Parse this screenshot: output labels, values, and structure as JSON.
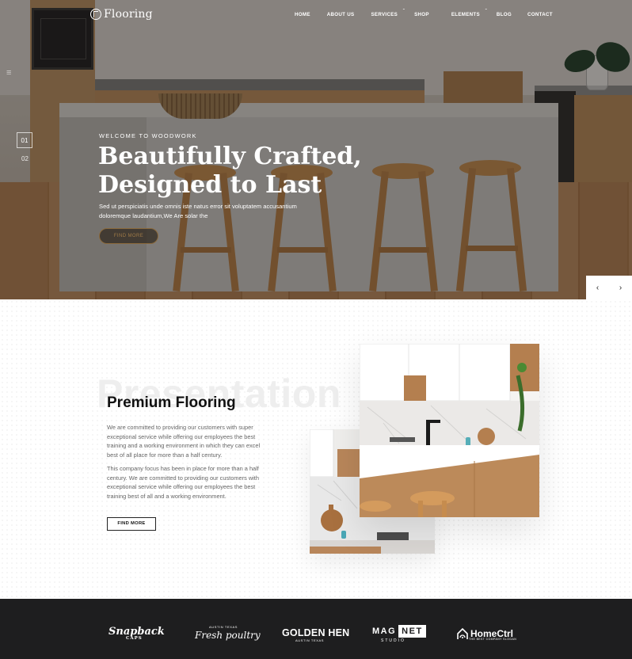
{
  "brand": {
    "logo_text": "Flooring",
    "logo_icon": "circle-leaf-icon"
  },
  "nav": {
    "items": [
      {
        "label": "HOME",
        "has_dropdown": false
      },
      {
        "label": "ABOUT US",
        "has_dropdown": false
      },
      {
        "label": "SERVICES",
        "has_dropdown": true
      },
      {
        "label": "SHOP",
        "has_dropdown": false
      },
      {
        "label": "ELEMENTS",
        "has_dropdown": true
      },
      {
        "label": "BLOG",
        "has_dropdown": false
      },
      {
        "label": "CONTACT",
        "has_dropdown": false
      }
    ]
  },
  "hero": {
    "kicker": "WELCOME TO WOODWORK",
    "title": "Beautifully Crafted, Designed to Last",
    "description": "Sed ut perspiciatis unde omnis iste natus error sit voluptatem accusantium doloremque laudantium,We Are solar the",
    "button_label": "FIND MORE",
    "slides": {
      "active": "01",
      "next": "02"
    },
    "prev_arrow": "‹",
    "next_arrow": "›"
  },
  "presentation": {
    "watermark": "Presentation",
    "title_plain": "Premium",
    "title_accent": "Flooring",
    "paragraph_1": "We are committed to providing our customers with super exceptional service while offering our employees the best training and a working environment in which they can excel best of all place for more than a half century.",
    "paragraph_2": "This company focus has been in place for more than a half century. We are committed to providing our customers with exceptional service while offering our employees the best training best of all and a working environment.",
    "button_label": "FIND MORE"
  },
  "brands": {
    "snapback": {
      "name": "Snapback",
      "sub": "CAPS"
    },
    "fresh": {
      "name": "Fresh poultry",
      "sub": "AUSTIN TEXAS"
    },
    "golden": {
      "name": "GOLDEN HEN",
      "sub": "AUSTIN TEXAS"
    },
    "magnet": {
      "mag": "MAG",
      "net": "NET",
      "sub": "STUDIO"
    },
    "homectrl": {
      "name": "HomeCtrl",
      "sub": "THE BEST COMPANY SLOGAN",
      "icon": "house-wifi-icon"
    }
  },
  "colors": {
    "accent": "#c07a35",
    "footer_bg": "#1e1e1f",
    "button_text": "#9f7a47"
  }
}
